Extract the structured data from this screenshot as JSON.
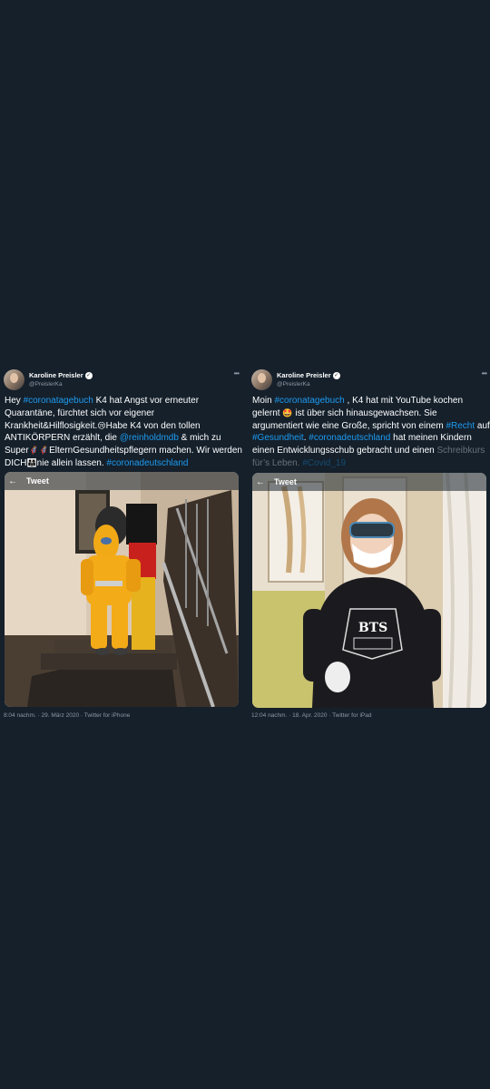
{
  "left_tweet": {
    "author_name": "Karoline Preisler",
    "author_handle": "@PreislerKa",
    "text_parts": [
      {
        "t": "Hey ",
        "link": false
      },
      {
        "t": "#coronatagebuch",
        "link": true
      },
      {
        "t": " K4 hat Angst vor erneuter Quarantäne, fürchtet sich vor eigener Krankheit&Hilflosigkeit.",
        "link": false
      },
      {
        "t": "😢",
        "emoji": true
      },
      {
        "t": "Habe K4 von den tollen ANTIKÖRPERN erzählt, die ",
        "link": false
      },
      {
        "t": "@reinholdmdb",
        "link": true
      },
      {
        "t": " & mich zu Super",
        "link": false
      },
      {
        "t": "🦸‍♀️🦸‍♂️",
        "emoji": true
      },
      {
        "t": "ElternGesundheitspflegern machen. Wir werden DICH",
        "link": false
      },
      {
        "t": "👨‍👩‍👧",
        "emoji": true
      },
      {
        "t": "nie allein lassen. ",
        "link": false
      },
      {
        "t": "#coronadeutschland",
        "link": true
      }
    ],
    "overlay_title": "Tweet",
    "meta": "8:04 nachm. · 29. März 2020 · Twitter for iPhone"
  },
  "right_tweet": {
    "author_name": "Karoline Preisler",
    "author_handle": "@PreislerKa",
    "text_parts": [
      {
        "t": "Moin ",
        "link": false
      },
      {
        "t": "#coronatagebuch",
        "link": true
      },
      {
        "t": " , K4 hat mit YouTube kochen gelernt ",
        "link": false
      },
      {
        "t": "🤩",
        "emoji": true
      },
      {
        "t": " ist über sich hinausgewachsen. Sie argumentiert wie eine Große, spricht von einem ",
        "link": false
      },
      {
        "t": "#Recht",
        "link": true
      },
      {
        "t": " auf ",
        "link": false
      },
      {
        "t": "#Gesundheit",
        "link": true
      },
      {
        "t": ". ",
        "link": false
      },
      {
        "t": "#coronadeutschland",
        "link": true
      },
      {
        "t": " hat meinen Kindern einen Entwicklungsschub gebracht und einen ",
        "link": false
      },
      {
        "t": "Schreibkurs für’s Leben. ",
        "link": false,
        "faded": true
      },
      {
        "t": "#Covid_19",
        "link": true,
        "faded": true
      }
    ],
    "overlay_title": "Tweet",
    "media_text": "BTS",
    "meta": "12:04 nachm. · 18. Apr. 2020 · Twitter for iPad"
  }
}
